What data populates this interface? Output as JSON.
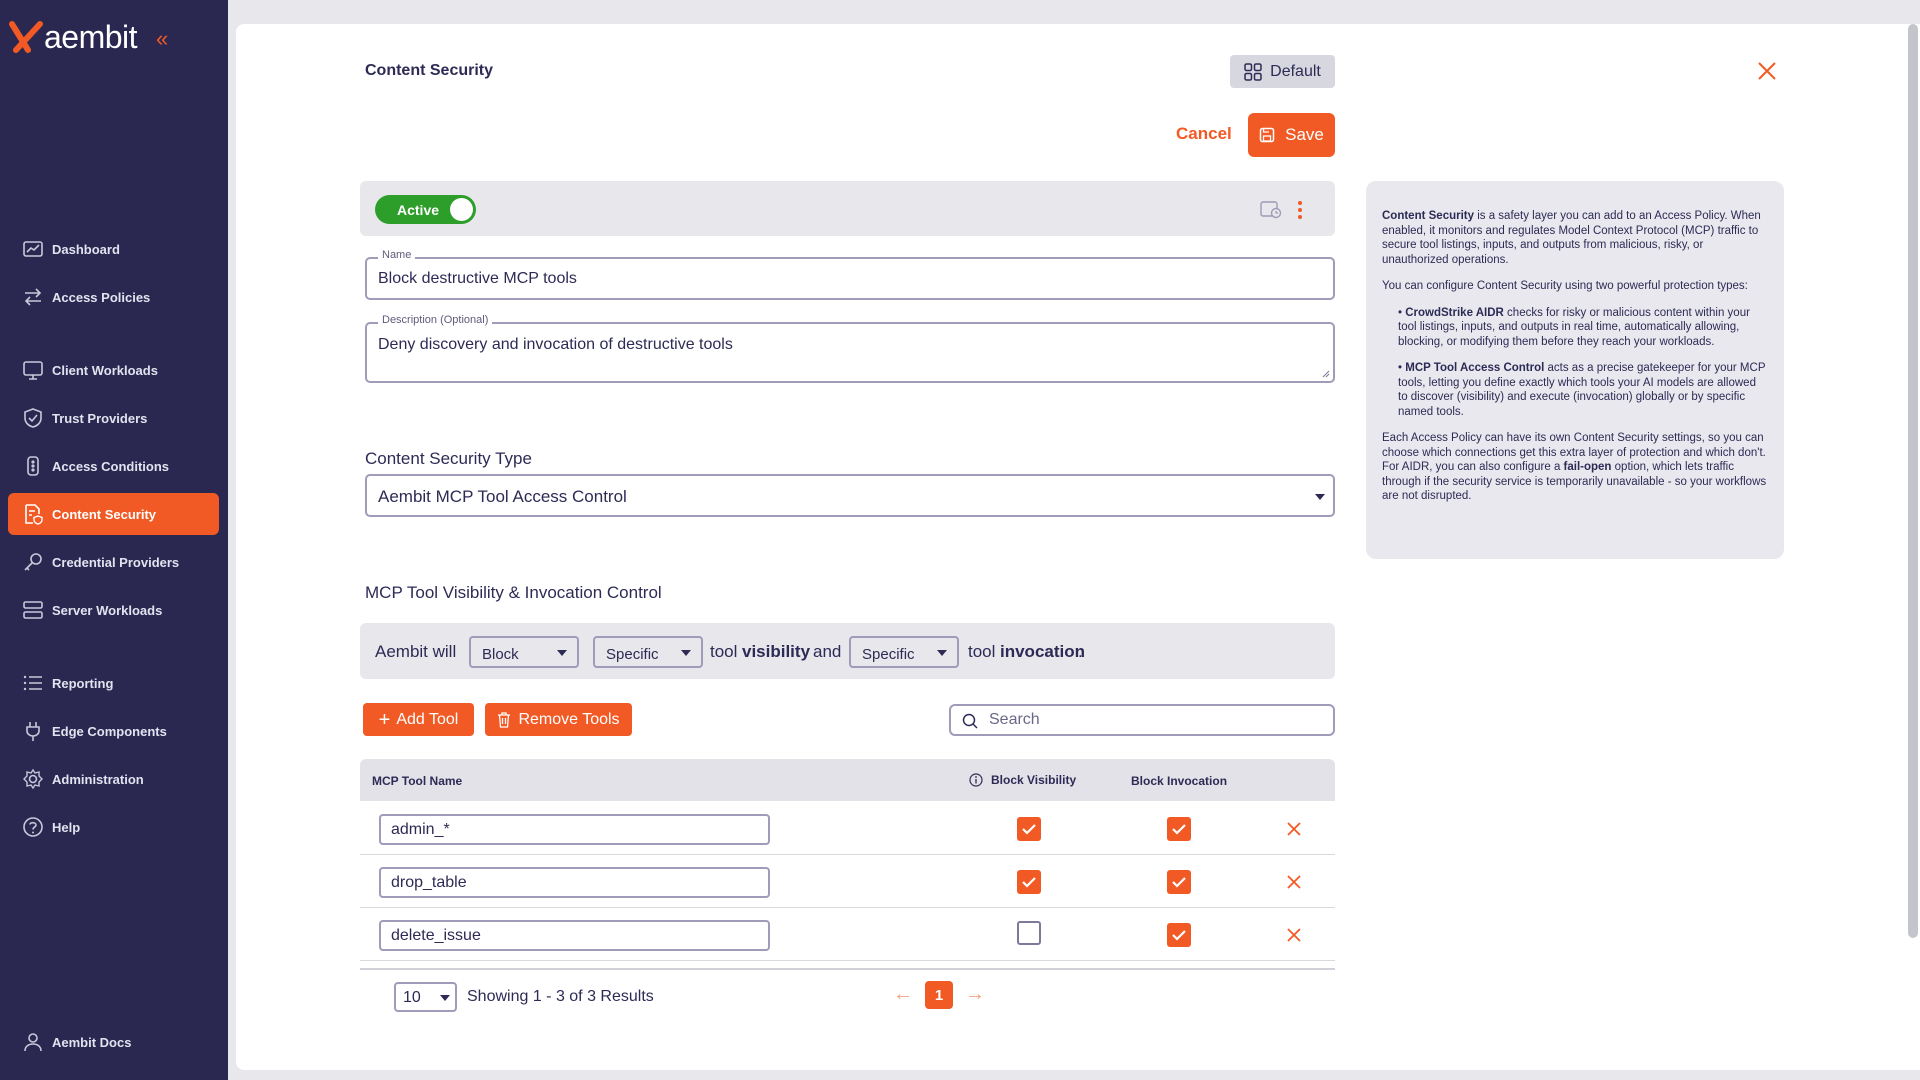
{
  "brand": {
    "name": "aembit",
    "accent": "#f15a24",
    "sidebar_bg": "#2a2850"
  },
  "sidebar": {
    "collapse_icon": "chevron-double-left-icon",
    "items": [
      {
        "label": "Dashboard",
        "icon": "dashboard-icon"
      },
      {
        "label": "Access Policies",
        "icon": "arrows-swap-icon"
      },
      {
        "label": "Client Workloads",
        "icon": "monitor-icon"
      },
      {
        "label": "Trust Providers",
        "icon": "shield-check-icon"
      },
      {
        "label": "Access Conditions",
        "icon": "traffic-light-icon"
      },
      {
        "label": "Content Security",
        "icon": "document-shield-icon",
        "active": true
      },
      {
        "label": "Credential Providers",
        "icon": "key-icon"
      },
      {
        "label": "Server Workloads",
        "icon": "server-icon"
      },
      {
        "label": "Reporting",
        "icon": "list-icon"
      },
      {
        "label": "Edge Components",
        "icon": "plug-icon"
      },
      {
        "label": "Administration",
        "icon": "gear-icon"
      },
      {
        "label": "Help",
        "icon": "question-icon"
      }
    ],
    "footer": {
      "label": "Aembit Docs",
      "icon": "person-icon"
    }
  },
  "header": {
    "title": "Content Security",
    "default_label": "Default",
    "cancel_label": "Cancel",
    "save_label": "Save"
  },
  "status": {
    "toggle_label": "Active",
    "toggle_on": true
  },
  "form": {
    "name_label": "Name",
    "name_value": "Block destructive MCP tools",
    "description_label": "Description (Optional)",
    "description_value": "Deny discovery and invocation of destructive tools",
    "type_label": "Content Security Type",
    "type_value": "Aembit MCP Tool Access Control"
  },
  "control": {
    "section_title": "MCP Tool Visibility & Invocation Control",
    "prefix": "Aembit will",
    "action": "Block",
    "visibility_scope": "Specific",
    "tool_word1": "tool",
    "visibility_word": "visibility",
    "and_word": "and",
    "invocation_scope": "Specific",
    "tool_word2": "tool",
    "invocation_word": "invocation",
    "period": "."
  },
  "actions": {
    "add_tool": "Add Tool",
    "remove_tools": "Remove Tools",
    "search_placeholder": "Search"
  },
  "table": {
    "columns": [
      "MCP Tool Name",
      "Block Visibility",
      "Block Invocation"
    ],
    "rows": [
      {
        "name": "admin_*",
        "block_visibility": true,
        "block_invocation": true
      },
      {
        "name": "drop_table",
        "block_visibility": true,
        "block_invocation": true
      },
      {
        "name": "delete_issue",
        "block_visibility": false,
        "block_invocation": true
      }
    ]
  },
  "pagination": {
    "per_page": "10",
    "showing": "Showing 1 - 3 of 3 Results",
    "current_page": "1"
  },
  "info": {
    "p1_bold": "Content Security",
    "p1_rest": " is a safety layer you can add to an Access Policy. When enabled, it monitors and regulates Model Context Protocol (MCP) traffic to secure tool listings, inputs, and outputs from malicious, risky, or unauthorized operations.",
    "p2": "You can configure Content Security using two powerful protection types:",
    "b1_bold": "CrowdStrike AIDR",
    "b1_rest": " checks for risky or malicious content within your tool listings, inputs, and outputs in real time, automatically allowing, blocking, or modifying them before they reach your workloads.",
    "b2_bold": "MCP Tool Access Control",
    "b2_rest": " acts as a precise gatekeeper for your MCP tools, letting you define exactly which tools your AI models are allowed to discover (visibility) and execute (invocation) globally or by specific named tools.",
    "p3_a": "Each Access Policy can have its own Content Security settings, so you can choose which connections get this extra layer of protection and which don't. For AIDR, you can also configure a ",
    "p3_bold": "fail-open",
    "p3_b": " option, which lets traffic through if the security service is temporarily unavailable - so your workflows are not disrupted."
  }
}
